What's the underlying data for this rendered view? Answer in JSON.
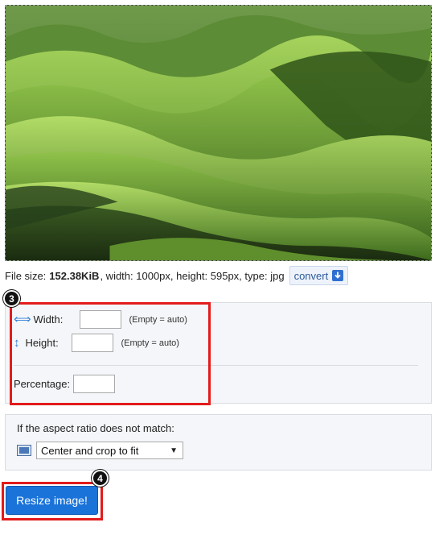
{
  "file_info": {
    "prefix": "File size:",
    "size": "152.38KiB",
    "rest": ", width: 1000px, height: 595px, type: jpg",
    "convert_label": "convert"
  },
  "dimensions": {
    "width_label": "Width:",
    "width_value": "",
    "height_label": "Height:",
    "height_value": "",
    "empty_hint": "(Empty = auto)",
    "percentage_label": "Percentage:",
    "percentage_value": ""
  },
  "aspect": {
    "title": "If the aspect ratio does not match:",
    "selected_option": "Center and crop to fit"
  },
  "resize_button": "Resize image!",
  "annotations": {
    "step3": "3",
    "step4": "4"
  },
  "colors": {
    "accent": "#1a73d9",
    "highlight": "#e31b1b",
    "icon_blue": "#2f7fd6"
  },
  "icons": [
    "horizontal-resize-icon",
    "vertical-resize-icon",
    "crop-icon",
    "download-icon",
    "chevron-down-icon"
  ]
}
